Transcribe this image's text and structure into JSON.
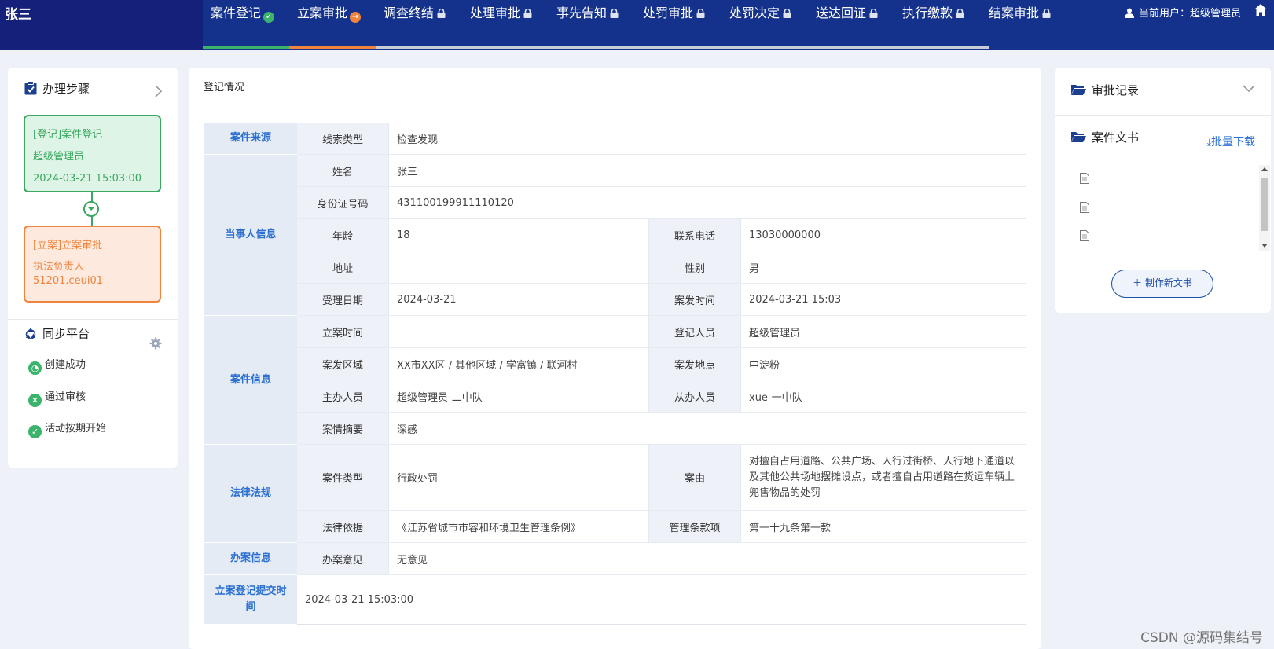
{
  "header": {
    "brand": "张三",
    "steps": [
      {
        "label": "案件登记",
        "status": "done"
      },
      {
        "label": "立案审批",
        "status": "current"
      },
      {
        "label": "调查终结",
        "status": "locked"
      },
      {
        "label": "处理审批",
        "status": "locked"
      },
      {
        "label": "事先告知",
        "status": "locked"
      },
      {
        "label": "处罚审批",
        "status": "locked"
      },
      {
        "label": "处罚决定",
        "status": "locked"
      },
      {
        "label": "送达回证",
        "status": "locked"
      },
      {
        "label": "执行缴款",
        "status": "locked"
      },
      {
        "label": "结案审批",
        "status": "locked"
      }
    ],
    "user_text": "当前用户：超级管理员"
  },
  "left_panel": {
    "title": "办理步骤",
    "cards": [
      {
        "line1": "[登记]案件登记",
        "line2": "超级管理员",
        "line3": "2024-03-21 15:03:00"
      },
      {
        "line1": "[立案]立案审批",
        "line2": "执法负责人",
        "line3": "51201,ceui01"
      }
    ],
    "sync_title": "同步平台",
    "sync_items": [
      {
        "label": "创建成功",
        "status": "clock"
      },
      {
        "label": "通过审核",
        "status": "error"
      },
      {
        "label": "活动按期开始",
        "status": "success"
      }
    ]
  },
  "main": {
    "title": "登记情况",
    "sections": [
      "案件来源",
      "当事人信息",
      "案件信息",
      "法律法规",
      "办案信息",
      "立案登记提交时间"
    ],
    "fields": {
      "clue_type_label": "线索类型",
      "clue_type": "检查发现",
      "name_label": "姓名",
      "name": "张三",
      "id_label": "身份证号码",
      "id": "431100199911110120",
      "age_label": "年龄",
      "age": "18",
      "phone_label": "联系电话",
      "phone": "13030000000",
      "address_label": "地址",
      "address": "",
      "gender_label": "性别",
      "gender": "男",
      "accept_date_label": "受理日期",
      "accept_date": "2024-03-21",
      "incident_time_label": "案发时间",
      "incident_time": "2024-03-21 15:03",
      "filing_time_label": "立案时间",
      "filing_time": "",
      "registrar_label": "登记人员",
      "registrar": "超级管理员",
      "area_label": "案发区域",
      "area": "XX市XX区 / 其他区域 / 学富镇 / 联河村",
      "place_label": "案发地点",
      "place": "中淀粉",
      "host_label": "主办人员",
      "host": "超级管理员-二中队",
      "assistant_label": "从办人员",
      "assistant": "xue-一中队",
      "summary_label": "案情摘要",
      "summary": "深感",
      "case_type_label": "案件类型",
      "case_type": "行政处罚",
      "cause_label": "案由",
      "cause": "对擅自占用道路、公共广场、人行过街桥、人行地下通道以及其他公共场地摆摊设点，或者擅自占用道路在货运车辆上兜售物品的处罚",
      "basis_label": "法律依据",
      "basis": "《江苏省城市市容和环境卫生管理条例》",
      "clause_label": "管理条款项",
      "clause": "第一十九条第一款",
      "opinion_label": "办案意见",
      "opinion": "无意见",
      "submit_time": "2024-03-21 15:03:00"
    }
  },
  "right_panel": {
    "approval_title": "审批记录",
    "docs_title": "案件文书",
    "batch_download": "批量下载",
    "new_doc_button": "制作新文书"
  },
  "watermark": "CSDN @源码集结号",
  "colors": {
    "nav_bg": "#14328c",
    "accent_blue": "#2b6fd0",
    "done_green": "#3ab46a",
    "current_orange": "#f0843c"
  }
}
